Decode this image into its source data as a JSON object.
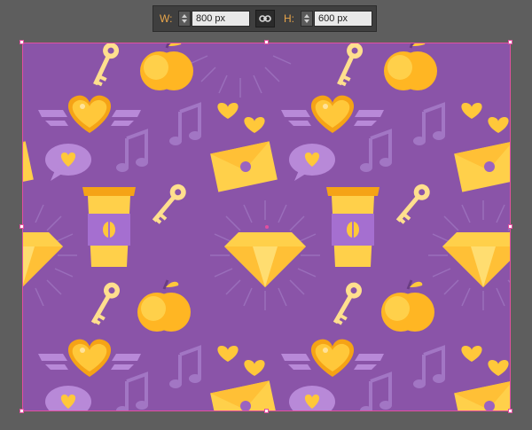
{
  "toolbar": {
    "width_label": "W:",
    "width_value": "800 px",
    "height_label": "H:",
    "height_value": "600 px",
    "link_icon": "link-icon"
  },
  "colors": {
    "background": "#5e5e5e",
    "artboard": "#8a54a8",
    "accent_yellow": "#ffc83a",
    "accent_orange": "#f5a316",
    "light_purple": "#b889d8",
    "selection": "#e24fa0"
  },
  "artboard": {
    "pattern_icons": [
      "heart-wings-icon",
      "key-icon",
      "apple-icon",
      "music-note-icon",
      "envelope-icon",
      "speech-bubble-icon",
      "coffee-cup-icon",
      "diamond-icon",
      "small-heart-icon"
    ]
  }
}
